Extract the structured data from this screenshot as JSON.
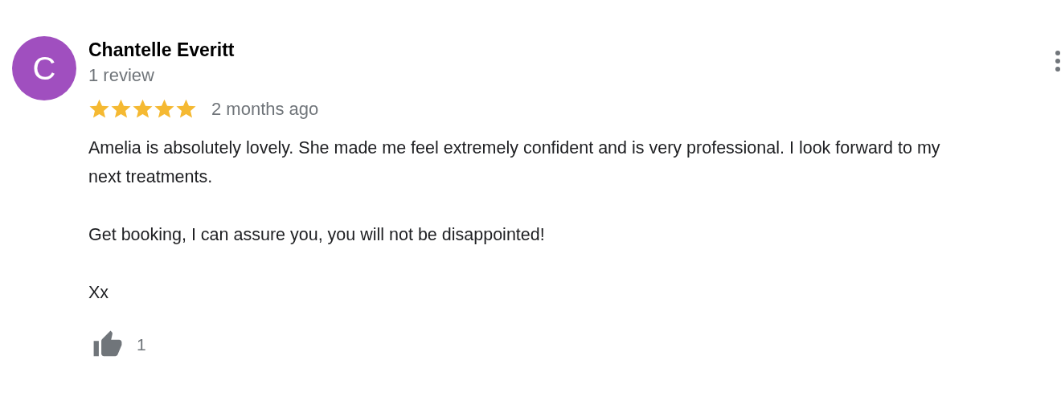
{
  "review": {
    "avatar_letter": "C",
    "author": "Chantelle Everitt",
    "review_count": "1 review",
    "stars": 5,
    "time": "2 months ago",
    "paragraphs": [
      "Amelia is absolutely lovely. She made me feel extremely confident and is very professional. I look forward to my next treatments.",
      "Get booking, I can assure you, you will not be disappointed!",
      "Xx"
    ],
    "likes": "1"
  }
}
